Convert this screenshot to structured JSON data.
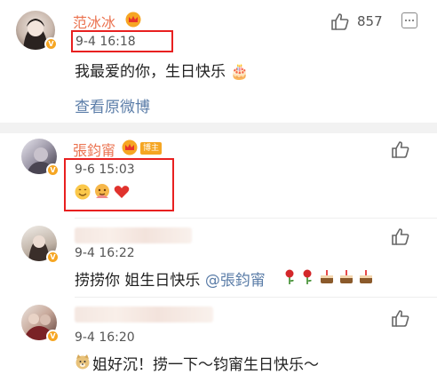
{
  "comments": [
    {
      "username": "范冰冰",
      "time": "9-4 16:18",
      "text": "我最爱的你，生日快乐",
      "cake_emoji": "🎂",
      "view_original": "查看原微博",
      "likes": "857"
    },
    {
      "username": "張鈞甯",
      "badge": "博主",
      "time": "9-6 15:03"
    },
    {
      "time": "9-4 16:22",
      "text_prefix": "捞捞你 姐生日快乐",
      "mention": "@張鈞甯"
    },
    {
      "time": "9-4 16:20",
      "text": "姐好沉！捞一下～钧甯生日快乐～"
    }
  ],
  "colors": {
    "username": "#eb7350",
    "link": "#5b7da8",
    "highlight_box": "#e82020",
    "badge": "#f6a623"
  }
}
